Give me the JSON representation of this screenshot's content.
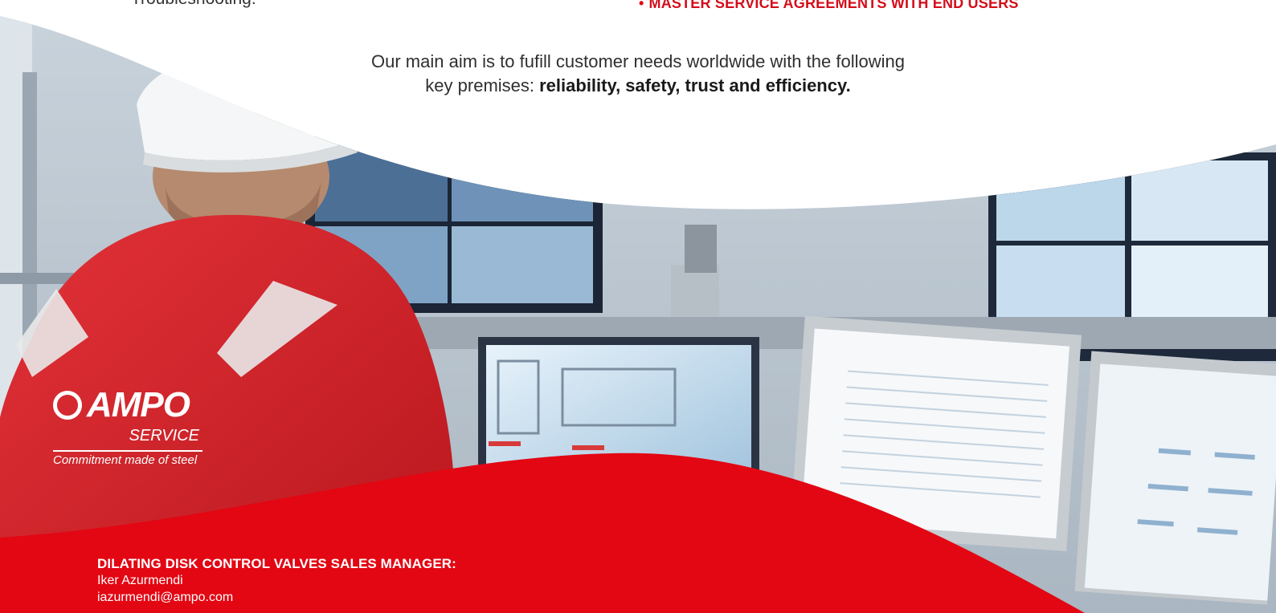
{
  "colors": {
    "brand_red": "#e30613",
    "text_dark": "#2f2f2f",
    "background": "#ffffff"
  },
  "top_fragments": {
    "left": "Troubleshooting.",
    "right": "MASTER SERVICE AGREEMENTS WITH END USERS"
  },
  "aim": {
    "line1": "Our main aim is to fufill customer needs worldwide with the following",
    "line2_prefix": "key premises: ",
    "line2_bold": "reliability, safety, trust and efficiency."
  },
  "photo": {
    "logo_text": "AMPO",
    "logo_sub": "SERVICE",
    "tagline": "Commitment made of steel"
  },
  "contact": {
    "title": "DILATING DISK CONTROL VALVES SALES MANAGER:",
    "name": "Iker Azurmendi",
    "email": "iazurmendi@ampo.com"
  }
}
